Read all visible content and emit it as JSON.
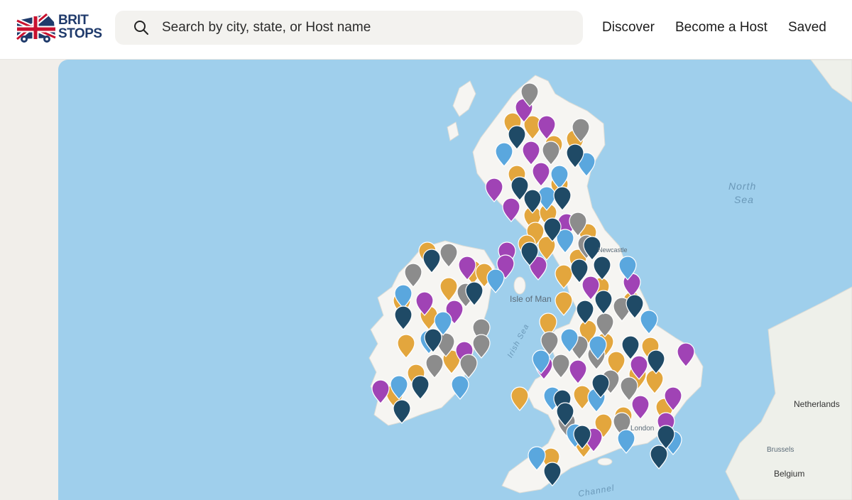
{
  "header": {
    "logo_line1": "BRIT",
    "logo_line2": "STOPS",
    "search_placeholder": "Search by city, state, or Host name",
    "nav": [
      "Discover",
      "Become a Host",
      "Saved"
    ]
  },
  "map": {
    "place_labels": {
      "north_sea_1": "North",
      "north_sea_2": "Sea",
      "isle_of_man": "Isle of Man",
      "irish_sea": "Irish Sea",
      "netherlands": "Netherlands",
      "brussels": "Brussels",
      "belgium": "Belgium",
      "london": "London",
      "channel": "Channel",
      "newcastle": "Newcastle"
    },
    "pin_colors": {
      "pub": "#e3a63d",
      "farm": "#a043b5",
      "parking": "#8c8c8c",
      "attraction": "#5aa7de",
      "golf": "#1f4a66"
    }
  }
}
